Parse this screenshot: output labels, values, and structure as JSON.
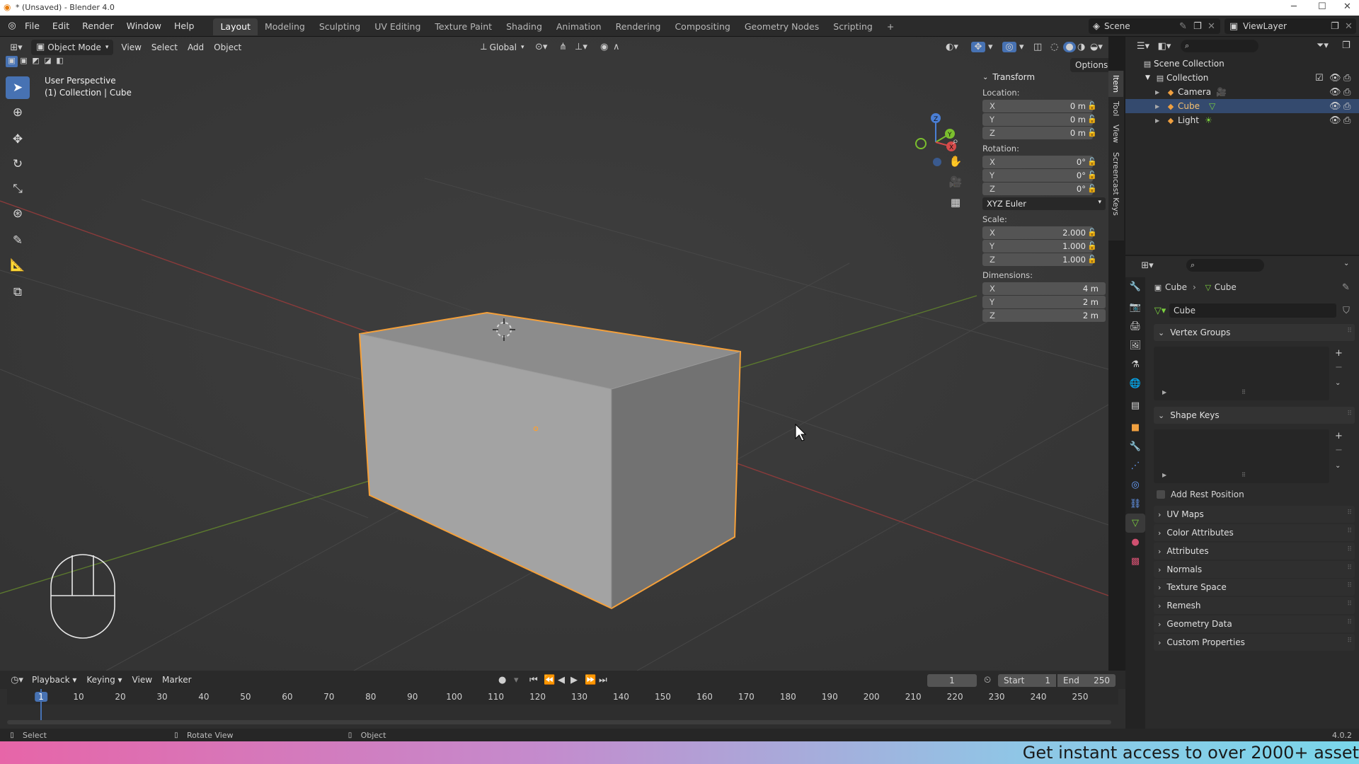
{
  "titlebar": {
    "title": "* (Unsaved) - Blender 4.0"
  },
  "menu": {
    "items": [
      "File",
      "Edit",
      "Render",
      "Window",
      "Help"
    ],
    "workspaces": [
      "Layout",
      "Modeling",
      "Sculpting",
      "UV Editing",
      "Texture Paint",
      "Shading",
      "Animation",
      "Rendering",
      "Compositing",
      "Geometry Nodes",
      "Scripting"
    ],
    "active_workspace": "Layout",
    "add_tab": "+",
    "scene_label": "Scene",
    "viewlayer_label": "ViewLayer"
  },
  "viewport_header": {
    "mode": "Object Mode",
    "menus": [
      "View",
      "Select",
      "Add",
      "Object"
    ],
    "orientation": "Global",
    "options": "Options"
  },
  "viewport": {
    "perspective": "User Perspective",
    "collection_info": "(1) Collection | Cube",
    "gizmo": {
      "x": "X",
      "y": "Y",
      "z": "Z"
    }
  },
  "npanel": {
    "title": "Transform",
    "location_label": "Location:",
    "location": [
      {
        "axis": "X",
        "value": "0 m"
      },
      {
        "axis": "Y",
        "value": "0 m"
      },
      {
        "axis": "Z",
        "value": "0 m"
      }
    ],
    "rotation_label": "Rotation:",
    "rotation": [
      {
        "axis": "X",
        "value": "0°"
      },
      {
        "axis": "Y",
        "value": "0°"
      },
      {
        "axis": "Z",
        "value": "0°"
      }
    ],
    "rotation_mode": "XYZ Euler",
    "scale_label": "Scale:",
    "scale": [
      {
        "axis": "X",
        "value": "2.000"
      },
      {
        "axis": "Y",
        "value": "1.000"
      },
      {
        "axis": "Z",
        "value": "1.000"
      }
    ],
    "dimensions_label": "Dimensions:",
    "dimensions": [
      {
        "axis": "X",
        "value": "4 m"
      },
      {
        "axis": "Y",
        "value": "2 m"
      },
      {
        "axis": "Z",
        "value": "2 m"
      }
    ],
    "tabs": [
      "Item",
      "Tool",
      "View",
      "Screencast Keys"
    ]
  },
  "outliner": {
    "root": "Scene Collection",
    "collection": "Collection",
    "items": [
      "Camera",
      "Cube",
      "Light"
    ],
    "selected": "Cube"
  },
  "properties": {
    "breadcrumb_object": "Cube",
    "breadcrumb_data": "Cube",
    "mesh_name": "Cube",
    "panels": [
      "Vertex Groups",
      "Shape Keys",
      "UV Maps",
      "Color Attributes",
      "Attributes",
      "Normals",
      "Texture Space",
      "Remesh",
      "Geometry Data",
      "Custom Properties"
    ],
    "add_rest_position": "Add Rest Position"
  },
  "timeline": {
    "menus": [
      "Playback",
      "Keying",
      "View",
      "Marker"
    ],
    "current_frame": "1",
    "start_label": "Start",
    "start": "1",
    "end_label": "End",
    "end": "250",
    "ticks": [
      "1",
      "10",
      "20",
      "30",
      "40",
      "50",
      "60",
      "70",
      "80",
      "90",
      "100",
      "110",
      "120",
      "130",
      "140",
      "150",
      "160",
      "170",
      "180",
      "190",
      "200",
      "210",
      "220",
      "230",
      "240",
      "250"
    ]
  },
  "statusbar": {
    "select": "Select",
    "rotate": "Rotate View",
    "object": "Object",
    "version": "4.0.2"
  },
  "ad": {
    "text": "Get instant access to over 2000+ asset"
  },
  "colors": {
    "accent": "#4772b3",
    "selection_outline": "#f5a03a",
    "x_axis": "#d64a4a",
    "y_axis": "#7bbf2e",
    "z_axis": "#4a7fd6"
  }
}
